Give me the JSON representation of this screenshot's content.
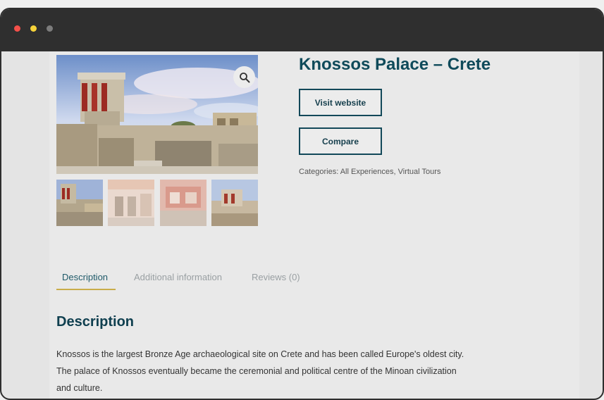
{
  "window": {
    "colors": {
      "titlebar": "#2f2f2f",
      "close": "#f4504a",
      "minimize": "#f6d33a",
      "maximize": "#7c7c7c"
    }
  },
  "gallery": {
    "zoom_icon": "magnifier-icon",
    "thumbnails": [
      {
        "name": "thumbnail-exterior"
      },
      {
        "name": "thumbnail-room-doorways"
      },
      {
        "name": "thumbnail-frescoed-room"
      },
      {
        "name": "thumbnail-ruins-view"
      }
    ]
  },
  "product": {
    "title": "Knossos Palace – Crete",
    "visit_label": "Visit website",
    "compare_label": "Compare",
    "categories": "Categories: All Experiences, Virtual Tours"
  },
  "tabs": [
    {
      "label": "Description",
      "active": true
    },
    {
      "label": "Additional information",
      "active": false
    },
    {
      "label": "Reviews (0)",
      "active": false
    }
  ],
  "description": {
    "heading": "Description",
    "lines": [
      "Knossos is the largest Bronze Age archaeological site on Crete and has been called Europe's oldest city.",
      "The palace of Knossos eventually became the ceremonial and political centre of the Minoan civilization",
      "and culture."
    ]
  },
  "colors": {
    "accent": "#0f4a5a",
    "tab_underline": "#c9ad4a"
  }
}
